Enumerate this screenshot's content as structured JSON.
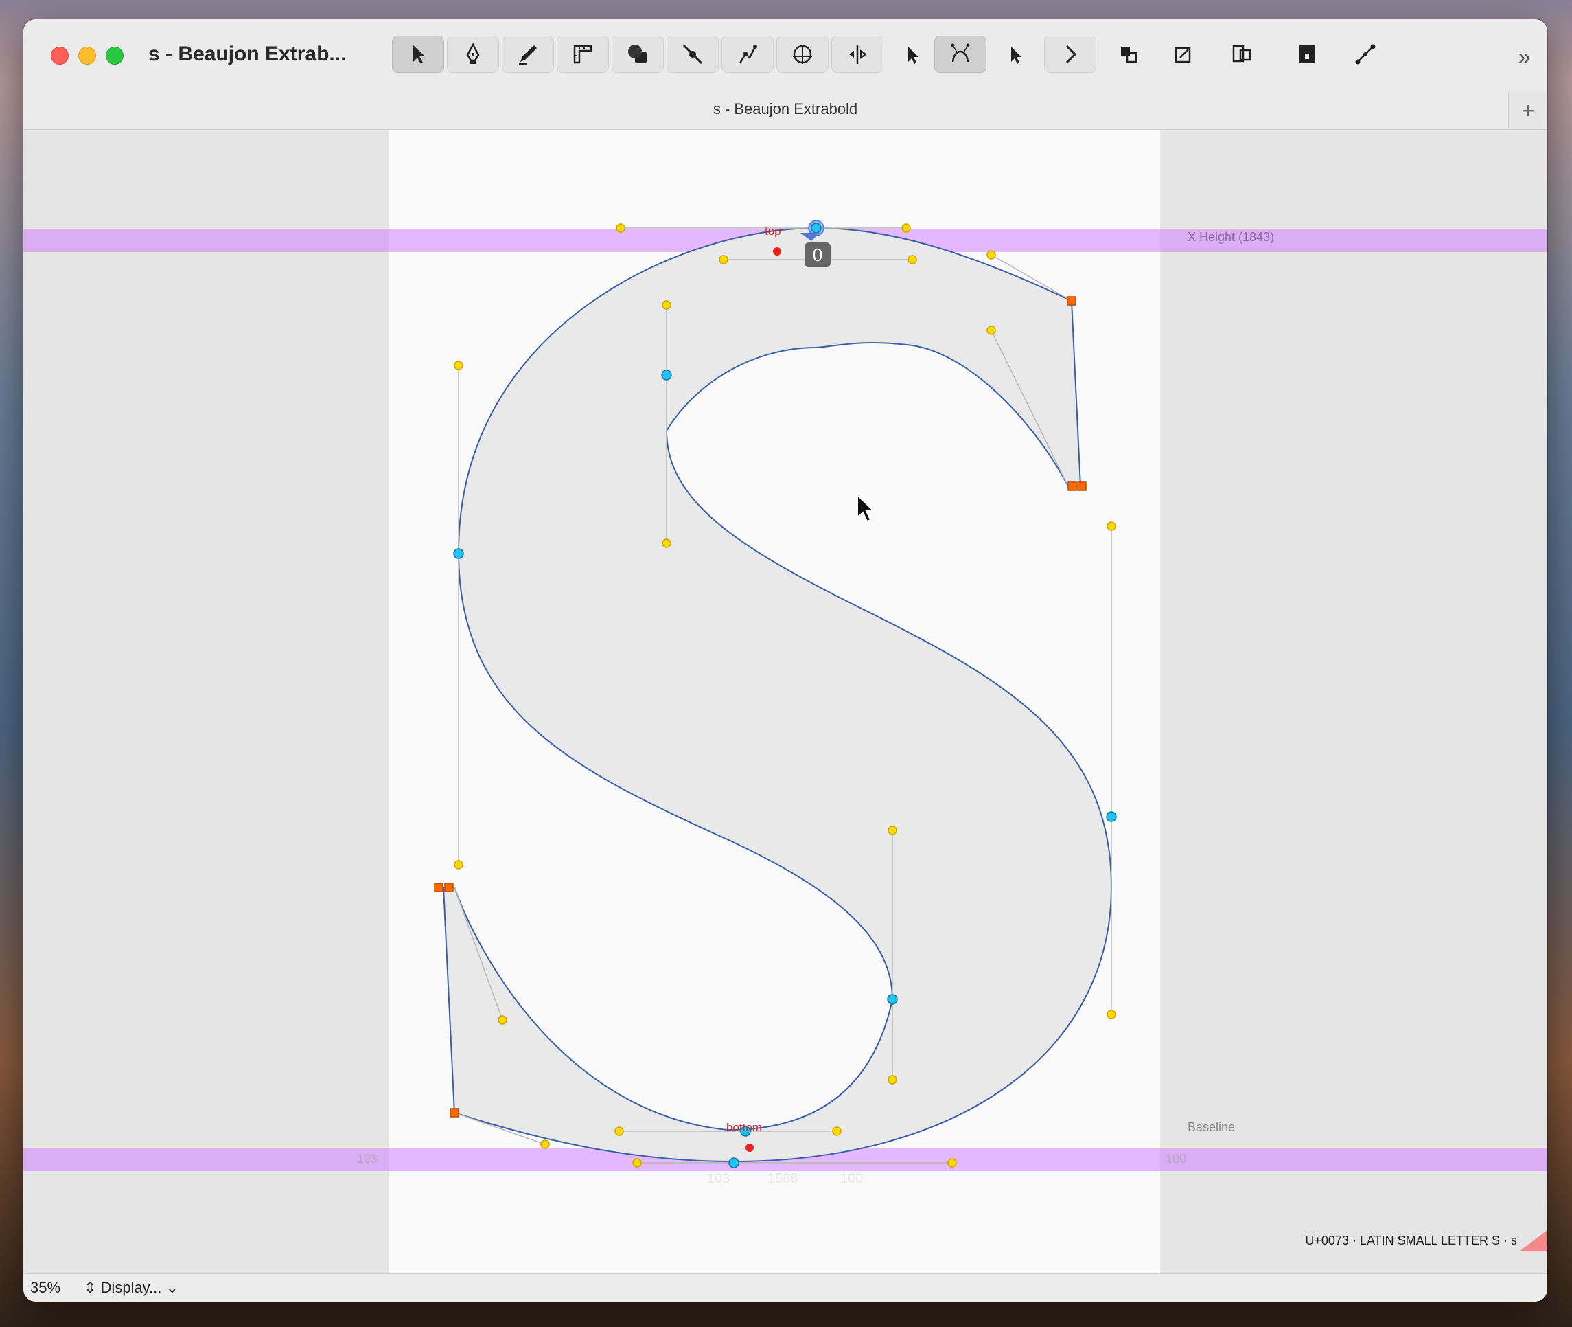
{
  "window": {
    "title": "s - Beaujon Extrab...",
    "tab_title": "s - Beaujon Extrabold",
    "add_tab": "+"
  },
  "toolbar": {
    "tools": [
      {
        "name": "select-tool",
        "icon": "arrow-pointer-icon",
        "active": true
      },
      {
        "name": "pen-tool",
        "icon": "pen-nib-icon",
        "active": false
      },
      {
        "name": "pencil-tool",
        "icon": "pencil-icon",
        "active": false
      },
      {
        "name": "measure-tool",
        "icon": "ruler-icon",
        "active": false
      },
      {
        "name": "shapes-tool",
        "icon": "shapes-icon",
        "active": false
      },
      {
        "name": "knife-tool",
        "icon": "knife-icon",
        "active": false
      },
      {
        "name": "node-tool",
        "icon": "node-pen-icon",
        "active": false
      },
      {
        "name": "anchor-tool",
        "icon": "anchor-circle-icon",
        "active": false
      },
      {
        "name": "transform-tool",
        "icon": "transform-icon",
        "active": false
      },
      {
        "name": "pointer-tool",
        "icon": "pointer-icon",
        "active": false
      },
      {
        "name": "curve-tool",
        "icon": "bezier-curve-icon",
        "active": true
      },
      {
        "name": "pointer-alt-tool",
        "icon": "pointer-icon",
        "active": false
      },
      {
        "name": "next-tool",
        "icon": "chevron-right-icon",
        "active": false
      }
    ],
    "right_tools": [
      {
        "name": "components-button",
        "icon": "components-icon"
      },
      {
        "name": "corner-button",
        "icon": "corner-icon"
      },
      {
        "name": "layers-button",
        "icon": "layers-icon"
      },
      {
        "name": "lock-button",
        "icon": "lock-icon"
      },
      {
        "name": "path-button",
        "icon": "line-path-icon"
      }
    ],
    "more": "»"
  },
  "canvas": {
    "x_height_label": "X Height (1843)",
    "baseline_label": "Baseline",
    "lsb": "103",
    "rsb": "100",
    "ghost_metrics": {
      "lsb": "103",
      "width": "1588",
      "rsb": "100"
    },
    "anchor_top": "top",
    "anchor_bottom": "bottom",
    "selected_node_badge": "0",
    "glyph_info": "U+0073 · LATIN SMALL LETTER S · s",
    "colors": {
      "metric_band": "#d98bff",
      "glyph_fill": "#e8e8e8",
      "outline": "#3a5ea8",
      "smooth_node": "#1fc4ef",
      "corner_node": "#ff6a00",
      "handle": "#ffd700",
      "anchor": "#e82020"
    }
  },
  "status": {
    "zoom": "35%",
    "display_label": "Display..."
  }
}
